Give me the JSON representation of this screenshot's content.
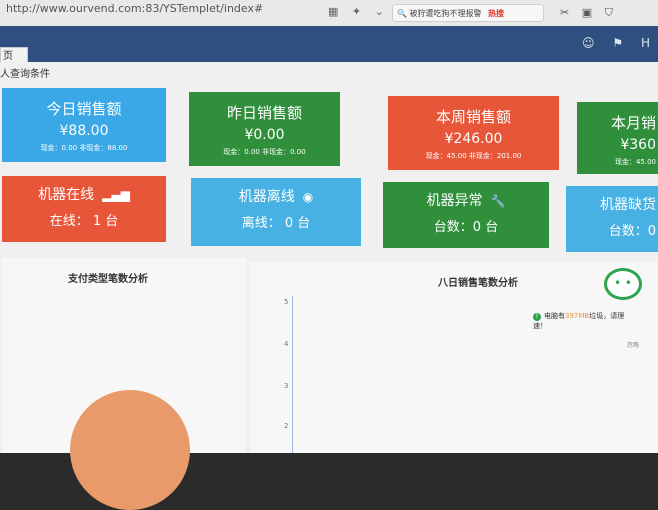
{
  "browser": {
    "url": "http://www.ourvend.com:83/YSTemplet/index#",
    "search_text": "被狩遭吃狗不理报警",
    "search_hot": "热搜"
  },
  "header": {
    "tab_label": "页"
  },
  "filter": {
    "label": "人查询条件"
  },
  "sales_cards": [
    {
      "title": "今日销售额",
      "amount": "¥88.00",
      "sub": "现金：0.00  非现金：88.00",
      "color": "#3aa7e6"
    },
    {
      "title": "昨日销售额",
      "amount": "¥0.00",
      "sub": "现金：0.00  非现金：0.00",
      "color": "#2f8f3b"
    },
    {
      "title": "本周销售额",
      "amount": "¥246.00",
      "sub": "现金：45.00  非现金：201.00",
      "color": "#e8563a"
    },
    {
      "title": "本月销",
      "amount": "¥360",
      "sub": "现金：45.00",
      "color": "#2f8f3b"
    }
  ],
  "machine_cards": [
    {
      "title": "机器在线",
      "value": "在线： 1 台",
      "icon": "signal-bars-icon"
    },
    {
      "title": "机器离线",
      "value": "离线： 0 台",
      "icon": "globe-icon"
    },
    {
      "title": "机器异常",
      "value": "台数：0 台",
      "icon": "wrench-icon"
    },
    {
      "title": "机器缺货",
      "value": "台数：0",
      "icon": "box-icon"
    }
  ],
  "panels": {
    "pie_title": "支付类型笔数分析",
    "line_title": "八日销售笔数分析",
    "y_ticks": [
      "5",
      "4",
      "3",
      "2"
    ]
  },
  "tip": {
    "text_prefix": "电脑有",
    "highlight": "397MB",
    "text_suffix": "垃圾，请理",
    "line2": "速！",
    "small": "忽略"
  },
  "colors": {
    "header": "#2e4f7f",
    "blue": "#3aa7e6",
    "green": "#2f8f3b",
    "red": "#e8563a"
  }
}
